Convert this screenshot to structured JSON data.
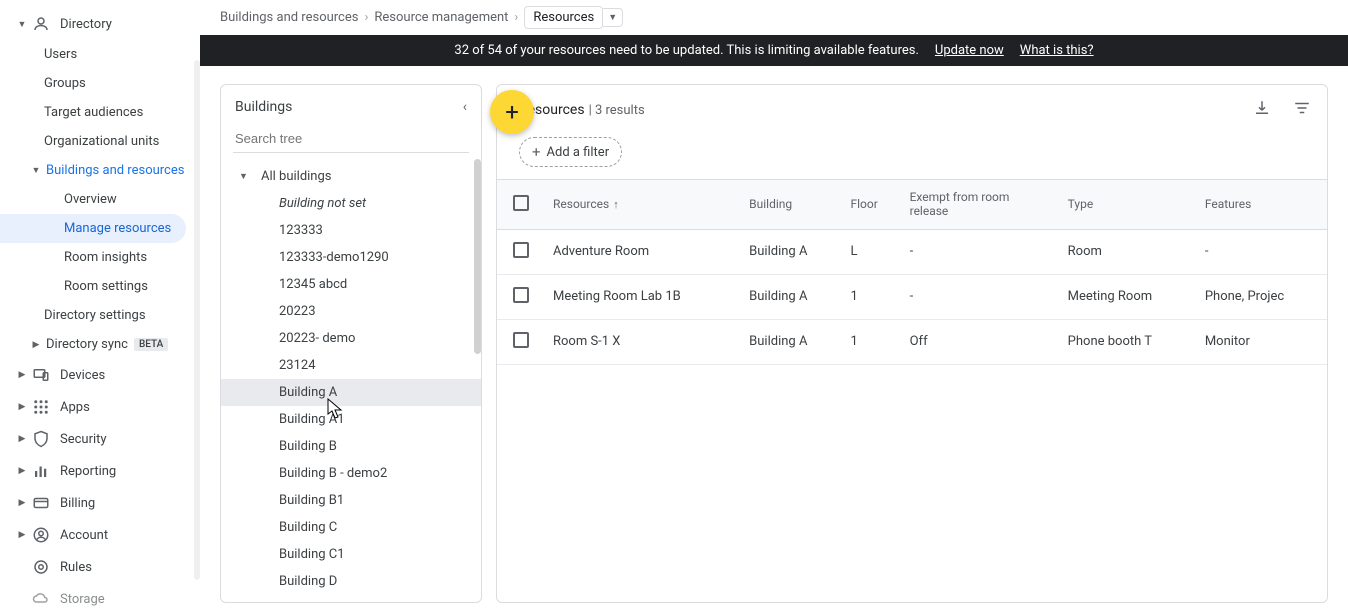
{
  "breadcrumb": {
    "item1": "Buildings and resources",
    "item2": "Resource management",
    "current": "Resources"
  },
  "banner": {
    "text": "32 of 54 of your resources need to be updated. This is limiting available features.",
    "link1": "Update now",
    "link2": "What is this?"
  },
  "sidebar": {
    "directory": "Directory",
    "users": "Users",
    "groups": "Groups",
    "target_audiences": "Target audiences",
    "org_units": "Organizational units",
    "buildings_resources": "Buildings and resources",
    "overview": "Overview",
    "manage_resources": "Manage resources",
    "room_insights": "Room insights",
    "room_settings": "Room settings",
    "directory_settings": "Directory settings",
    "directory_sync": "Directory sync",
    "beta": "BETA",
    "devices": "Devices",
    "apps": "Apps",
    "security": "Security",
    "reporting": "Reporting",
    "billing": "Billing",
    "account": "Account",
    "rules": "Rules",
    "storage": "Storage"
  },
  "buildings_panel": {
    "title": "Buildings",
    "search_placeholder": "Search tree",
    "root": "All buildings",
    "items": {
      "i0": "Building not set",
      "i1": "123333",
      "i2": "123333-demo1290",
      "i3": "12345 abcd",
      "i4": "20223",
      "i5": "20223- demo",
      "i6": "23124",
      "i7": "Building A",
      "i8": "Building A1",
      "i9": "Building B",
      "i10": "Building B - demo2",
      "i11": "Building B1",
      "i12": "Building C",
      "i13": "Building C1",
      "i14": "Building D"
    }
  },
  "resources": {
    "title": "Resources",
    "count_text": "| 3 results",
    "filter_label": "Add a filter",
    "headers": {
      "resources": "Resources",
      "building": "Building",
      "floor": "Floor",
      "exempt_l1": "Exempt from room",
      "exempt_l2": "release",
      "type": "Type",
      "features": "Features"
    },
    "rows": {
      "r0": {
        "name": "Adventure Room",
        "building": "Building A",
        "floor": "L",
        "exempt": "-",
        "type": "Room",
        "features": "-"
      },
      "r1": {
        "name": "Meeting Room Lab 1B",
        "building": "Building A",
        "floor": "1",
        "exempt": "-",
        "type": "Meeting Room",
        "features": "Phone, Projec"
      },
      "r2": {
        "name": "Room S-1 X",
        "building": "Building A",
        "floor": "1",
        "exempt": "Off",
        "type": "Phone booth T",
        "features": "Monitor"
      }
    }
  }
}
